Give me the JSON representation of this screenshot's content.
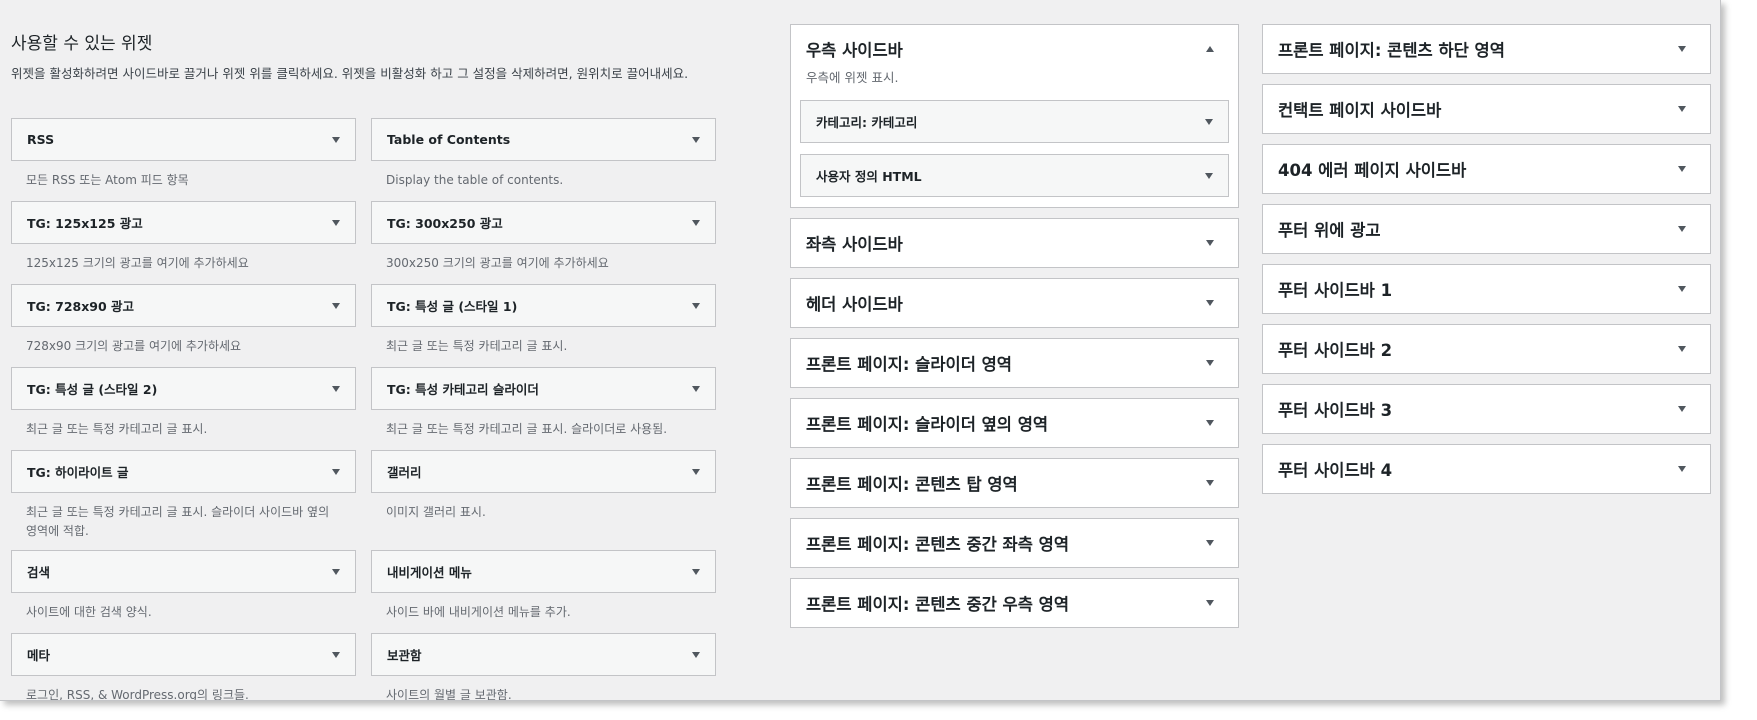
{
  "available": {
    "title": "사용할 수 있는 위젯",
    "description": "위젯을 활성화하려면 사이드바로 끌거나 위젯 위를 클릭하세요. 위젯을 비활성화 하고 그 설정을 삭제하려면, 원위치로 끌어내세요."
  },
  "widgets": [
    {
      "title": "RSS",
      "desc": "모든 RSS 또는 Atom 피드 항목"
    },
    {
      "title": "Table of Contents",
      "desc": "Display the table of contents."
    },
    {
      "title": "TG: 125x125 광고",
      "desc": "125x125 크기의 광고를 여기에 추가하세요"
    },
    {
      "title": "TG: 300x250 광고",
      "desc": "300x250 크기의 광고를 여기에 추가하세요"
    },
    {
      "title": "TG: 728x90 광고",
      "desc": "728x90 크기의 광고를 여기에 추가하세요"
    },
    {
      "title": "TG: 특성 글 (스타일 1)",
      "desc": "최근 글 또는 특정 카테고리 글 표시."
    },
    {
      "title": "TG: 특성 글 (스타일 2)",
      "desc": "최근 글 또는 특정 카테고리 글 표시."
    },
    {
      "title": "TG: 특성 카테고리 슬라이더",
      "desc": "최근 글 또는 특정 카테고리 글 표시. 슬라이더로 사용됨."
    },
    {
      "title": "TG: 하이라이트 글",
      "desc": "최근 글 또는 특정 카테고리 글 표시. 슬라이더 사이드바 옆의 영역에 적합."
    },
    {
      "title": "갤러리",
      "desc": "이미지 갤러리 표시."
    },
    {
      "title": "검색",
      "desc": "사이트에 대한 검색 양식."
    },
    {
      "title": "내비게이션 메뉴",
      "desc": "사이드 바에 내비게이션 메뉴를 추가."
    },
    {
      "title": "메타",
      "desc": "로그인, RSS, & WordPress.org의 링크들."
    },
    {
      "title": "보관함",
      "desc": "사이트의 월별 글 보관함."
    }
  ],
  "right_sidebar": {
    "name": "우측 사이드바",
    "description": "우측에 위젯 표시.",
    "widgets": [
      "카테고리: 카테고리",
      "사용자 정의 HTML"
    ]
  },
  "sidebars_col1": [
    "좌측 사이드바",
    "헤더 사이드바",
    "프론트 페이지: 슬라이더 영역",
    "프론트 페이지: 슬라이더 옆의 영역",
    "프론트 페이지: 콘텐츠 탑 영역",
    "프론트 페이지: 콘텐츠 중간 좌측 영역",
    "프론트 페이지: 콘텐츠 중간 우측 영역"
  ],
  "sidebars_col2": [
    "프론트 페이지: 콘텐츠 하단 영역",
    "컨택트 페이지 사이드바",
    "404 에러 페이지 사이드바",
    "푸터 위에 광고",
    "푸터 사이드바 1",
    "푸터 사이드바 2",
    "푸터 사이드바 3",
    "푸터 사이드바 4"
  ]
}
